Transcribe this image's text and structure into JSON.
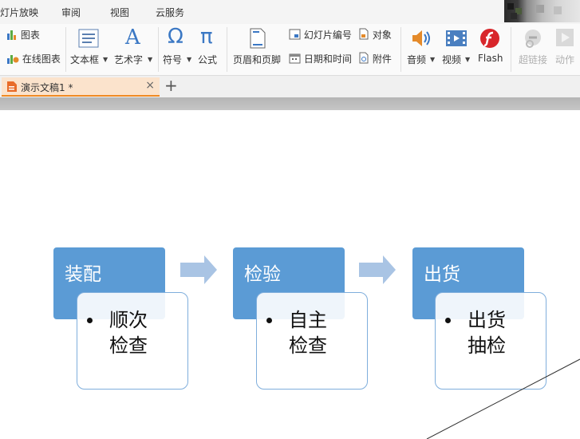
{
  "menu": {
    "tabs": [
      "灯片放映",
      "审阅",
      "视图",
      "云服务"
    ]
  },
  "ribbon": {
    "chart": "图表",
    "online_chart": "在线图表",
    "textbox": "文本框",
    "wordart": "艺术字",
    "symbol": "符号",
    "formula": "公式",
    "header_footer": "页眉和页脚",
    "slide_number": "幻灯片编号",
    "object": "对象",
    "date_time": "日期和时间",
    "attachment": "附件",
    "audio": "音频",
    "video": "视频",
    "flash": "Flash",
    "hyperlink": "超链接",
    "action": "动作",
    "wordart_glyph": "A",
    "symbol_glyph": "Ω",
    "formula_glyph": "π"
  },
  "doc_tabs": {
    "active_title": "演示文稿1 *",
    "close_glyph": "×",
    "new_tab_glyph": "+"
  },
  "slide": {
    "stages": [
      {
        "title": "装配",
        "lines": [
          "顺次",
          "检查"
        ]
      },
      {
        "title": "检验",
        "lines": [
          "自主",
          "检查"
        ]
      },
      {
        "title": "出货",
        "lines": [
          "出货",
          "抽检"
        ]
      }
    ]
  },
  "colors": {
    "stage_fill": "#5b9bd5",
    "arrow_fill": "#a9c4e4",
    "doc_tab_accent": "#f08a24"
  },
  "icons": {
    "chart": "bar-chart-icon",
    "online_chart": "online-chart-icon",
    "textbox": "textbox-icon",
    "header_footer": "page-icon",
    "slide_number": "slide-number-icon",
    "object": "object-icon",
    "date_time": "calendar-icon",
    "attachment": "attachment-icon",
    "audio": "speaker-icon",
    "video": "film-icon",
    "flash": "flash-icon",
    "hyperlink": "link-icon",
    "action": "play-icon"
  }
}
